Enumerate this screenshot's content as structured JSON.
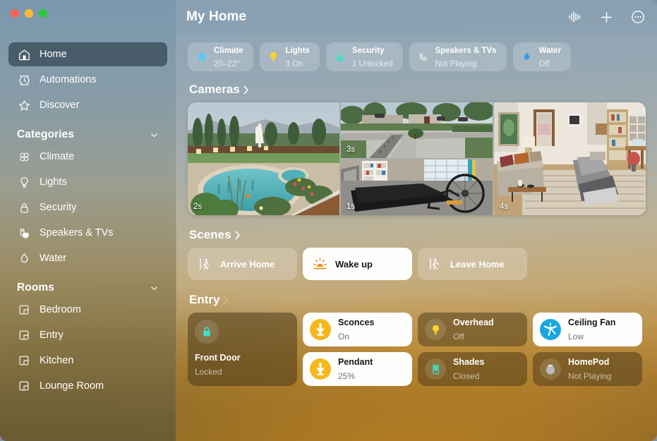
{
  "window": {
    "traffic_lights": [
      "close",
      "minimize",
      "zoom"
    ]
  },
  "header": {
    "title": "My Home",
    "actions": [
      {
        "name": "siri-waveform-icon",
        "label": "Siri"
      },
      {
        "name": "add-icon",
        "label": "Add"
      },
      {
        "name": "more-options-icon",
        "label": "More"
      }
    ]
  },
  "sidebar": {
    "nav": [
      {
        "label": "Home",
        "icon": "house-icon",
        "selected": true
      },
      {
        "label": "Automations",
        "icon": "clock-icon",
        "selected": false
      },
      {
        "label": "Discover",
        "icon": "star-icon",
        "selected": false
      }
    ],
    "categories_header": "Categories",
    "categories": [
      {
        "label": "Climate",
        "icon": "fan-icon"
      },
      {
        "label": "Lights",
        "icon": "lightbulb-icon"
      },
      {
        "label": "Security",
        "icon": "lock-icon"
      },
      {
        "label": "Speakers & TVs",
        "icon": "speaker-tv-icon"
      },
      {
        "label": "Water",
        "icon": "water-drop-icon"
      }
    ],
    "rooms_header": "Rooms",
    "rooms": [
      {
        "label": "Bedroom",
        "icon": "room-icon"
      },
      {
        "label": "Entry",
        "icon": "room-icon"
      },
      {
        "label": "Kitchen",
        "icon": "room-icon"
      },
      {
        "label": "Lounge Room",
        "icon": "room-icon"
      }
    ]
  },
  "status_pills": [
    {
      "title": "Climate",
      "status": "20–22°",
      "icon": "fan-icon",
      "color": "#5ac8f5"
    },
    {
      "title": "Lights",
      "status": "3 On",
      "icon": "lightbulb-icon",
      "color": "#ffd426"
    },
    {
      "title": "Security",
      "status": "1 Unlocked",
      "icon": "lock-icon",
      "color": "#3fe0c8"
    },
    {
      "title": "Speakers & TVs",
      "status": "Not Playing",
      "icon": "speaker-tv-icon",
      "color": "#d9d9d9"
    },
    {
      "title": "Water",
      "status": "Off",
      "icon": "water-drop-icon",
      "color": "#2e9bf0"
    }
  ],
  "cameras": {
    "header": "Cameras",
    "tiles": [
      {
        "name": "backyard-pool-camera",
        "timestamp": "2s"
      },
      {
        "name": "driveway-camera",
        "timestamp": "3s"
      },
      {
        "name": "garage-camera",
        "timestamp": "1s"
      },
      {
        "name": "living-room-camera",
        "timestamp": "4s"
      }
    ]
  },
  "scenes": {
    "header": "Scenes",
    "items": [
      {
        "label": "Arrive Home",
        "icon": "figure-walk-in-icon",
        "active": false
      },
      {
        "label": "Wake up",
        "icon": "sunrise-icon",
        "active": true,
        "color": "#f5891f"
      },
      {
        "label": "Leave Home",
        "icon": "figure-walk-out-icon",
        "active": false
      }
    ]
  },
  "entry": {
    "header": "Entry",
    "accessories": [
      {
        "name": "Front Door",
        "state": "Locked",
        "icon": "lock-icon",
        "color": "#3fe0c8",
        "active": false,
        "size": "large"
      },
      {
        "name": "Sconces",
        "state": "On",
        "icon": "sconce-light-icon",
        "color": "#f5b81c",
        "active": true
      },
      {
        "name": "Pendant",
        "state": "25%",
        "icon": "pendant-light-icon",
        "color": "#f5b81c",
        "active": true
      },
      {
        "name": "Overhead",
        "state": "Off",
        "icon": "lightbulb-icon",
        "color": "#ffd426",
        "active": false
      },
      {
        "name": "Shades",
        "state": "Closed",
        "icon": "shade-icon",
        "color": "#3fe0c8",
        "active": false
      },
      {
        "name": "Ceiling Fan",
        "state": "Low",
        "icon": "ceiling-fan-icon",
        "color": "#19a7e0",
        "active": true
      },
      {
        "name": "HomePod",
        "state": "Not Playing",
        "icon": "homepod-icon",
        "color": "#b9b9b9",
        "active": false
      }
    ]
  }
}
